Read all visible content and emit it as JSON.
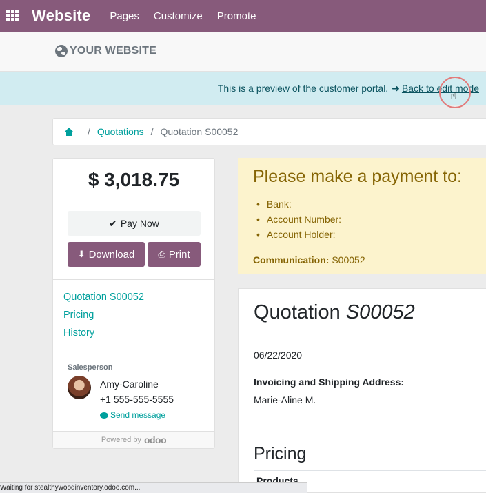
{
  "topbar": {
    "brand": "Website",
    "nav": [
      "Pages",
      "Customize",
      "Promote"
    ]
  },
  "site": {
    "logo_text": "YOUR WEBSITE"
  },
  "preview": {
    "message": "This is a preview of the customer portal.",
    "link_label": "Back to edit mode"
  },
  "breadcrumb": {
    "items": [
      "Quotations",
      "Quotation S00052"
    ]
  },
  "sidebar": {
    "amount": "$ 3,018.75",
    "pay_label": "Pay Now",
    "download_label": "Download",
    "print_label": "Print",
    "links": [
      "Quotation S00052",
      "Pricing",
      "History"
    ],
    "salesperson_label": "Salesperson",
    "salesperson_name": "Amy-Caroline",
    "salesperson_phone": "+1 555-555-5555",
    "send_message_label": "Send message",
    "powered_by": "Powered by",
    "odoo_o": "o",
    "odoo_rest": "doo"
  },
  "payment": {
    "title": "Please make a payment to:",
    "items": [
      "Bank:",
      "Account Number:",
      "Account Holder:"
    ],
    "communication_label": "Communication:",
    "communication_value": "S00052"
  },
  "quotation": {
    "title_prefix": "Quotation",
    "title_number": "S00052",
    "date": "06/22/2020",
    "address_label": "Invoicing and Shipping Address:",
    "address_name": "Marie-Aline M.",
    "pricing_title": "Pricing",
    "products_header": "Products"
  },
  "statusbar": {
    "text": "Waiting for stealthywoodinventory.odoo.com..."
  },
  "colors": {
    "brand_purple": "#875a7b",
    "link_teal": "#00a09d",
    "preview_bg": "#d1ecf1",
    "payment_bg": "#fcf3cd"
  },
  "icons": {
    "apps": "apps-grid-icon",
    "globe": "globe-icon",
    "arrow": "arrow-right-icon",
    "home": "home-icon",
    "check": "check-icon",
    "download": "download-icon",
    "print": "print-icon",
    "chat": "chat-icon"
  }
}
